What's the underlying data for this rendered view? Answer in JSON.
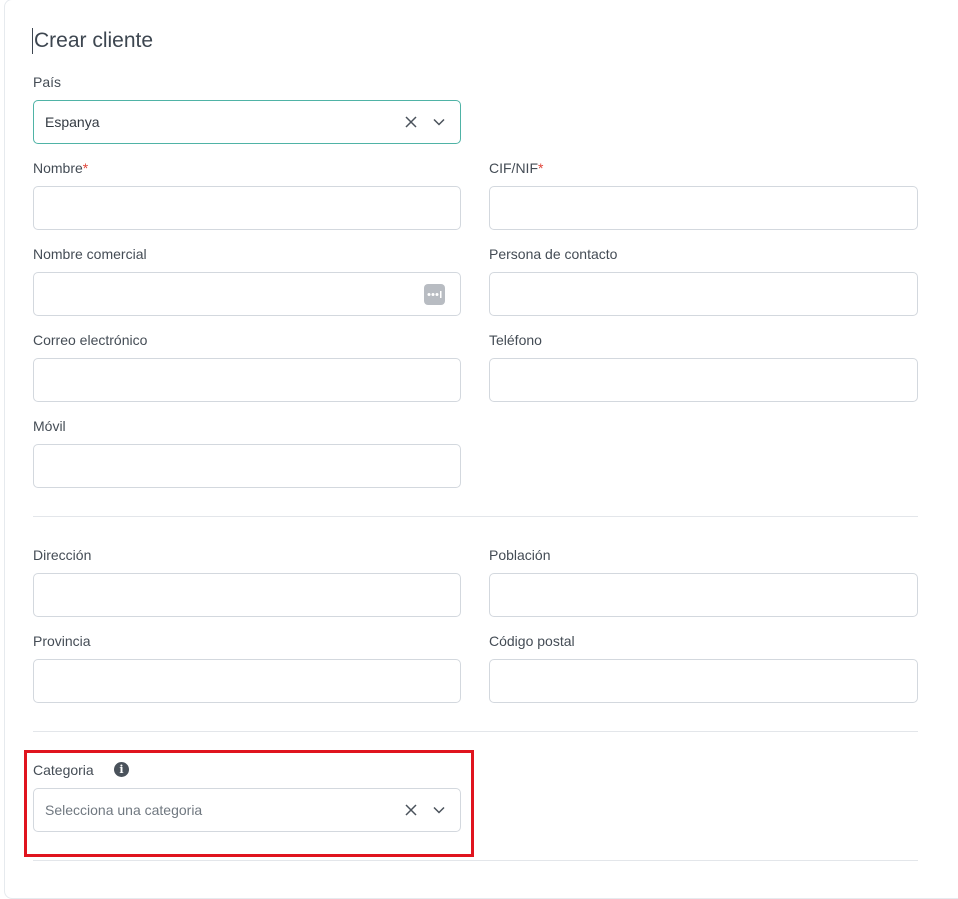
{
  "form": {
    "title": "Crear cliente",
    "country": {
      "label": "País",
      "value": "Espanya"
    },
    "name": {
      "label": "Nombre",
      "required_mark": "*"
    },
    "tax_id": {
      "label": "CIF/NIF",
      "required_mark": "*"
    },
    "trade_name": {
      "label": "Nombre comercial"
    },
    "contact_person": {
      "label": "Persona de contacto"
    },
    "email": {
      "label": "Correo electrónico"
    },
    "phone": {
      "label": "Teléfono"
    },
    "mobile": {
      "label": "Móvil"
    },
    "address": {
      "label": "Dirección"
    },
    "city": {
      "label": "Población"
    },
    "province": {
      "label": "Provincia"
    },
    "postal_code": {
      "label": "Código postal"
    },
    "category": {
      "label": "Categoria",
      "placeholder": "Selecciona una categoria"
    }
  },
  "colors": {
    "focus_border": "#4fb3a6",
    "required": "#e0453a",
    "highlight": "#e0141e"
  },
  "icons": {
    "clear": "close-icon",
    "dropdown": "chevron-down-icon",
    "autofill": "password-manager-icon",
    "info": "info-icon"
  }
}
